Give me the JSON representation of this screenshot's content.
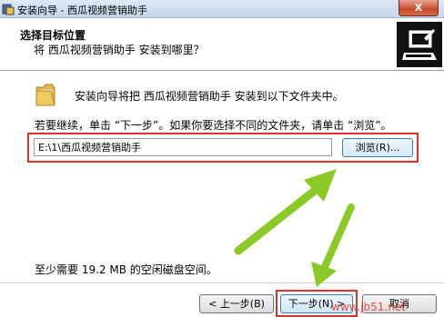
{
  "window": {
    "title": "安装向导 - 西瓜视频营销助手",
    "close_label": "X"
  },
  "header": {
    "title": "选择目标位置",
    "subtitle": "将 西瓜视频营销助手 安装到哪里？"
  },
  "content": {
    "intro": "安装向导将把 西瓜视频营销助手 安装到以下文件夹中。",
    "instruction": "若要继续，单击 “下一步”。如果你要选择不同的文件夹，请单击 “浏览”。",
    "install_path": "E:\\1\\西瓜视频营销助手",
    "browse_label": "浏览(R)...",
    "space_required": "至少需要 19.2 MB 的空闲磁盘空间。"
  },
  "footer": {
    "back_label": "< 上一步(B)",
    "next_label": "下一步(N) >",
    "cancel_label": "取消"
  },
  "watermark": "www.jb51.net",
  "colors": {
    "highlight_frame": "#e0302a",
    "arrow": "#8ac926"
  }
}
